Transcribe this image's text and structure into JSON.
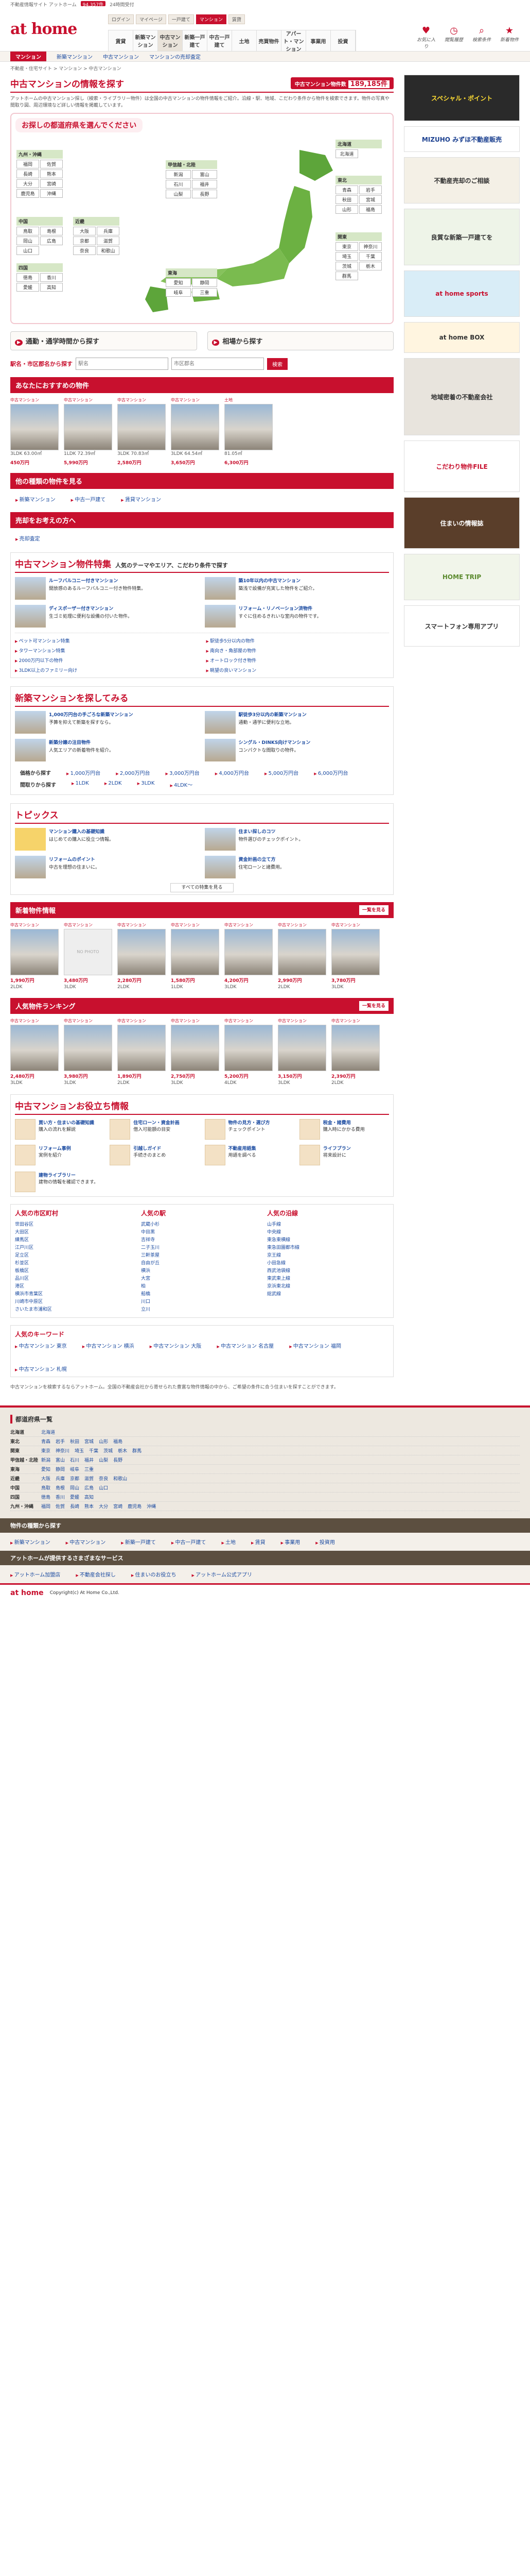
{
  "topstrip": {
    "tagline": "不動産情報サイト アットホーム",
    "badge": "94,357件",
    "note": "24時間受付"
  },
  "header": {
    "logo": "at home",
    "tabs": [
      "ログイン",
      "マイページ",
      "一戸建て",
      "マンション",
      "賃貸"
    ],
    "nav": [
      "賃貸",
      "新築マンション",
      "中古マンション",
      "新築一戸建て",
      "中古一戸建て",
      "土地",
      "売買物件",
      "アパート・マンション",
      "事業用",
      "投資"
    ],
    "icons": [
      {
        "icon": "heart-icon",
        "label": "お気に入り"
      },
      {
        "icon": "clock-icon",
        "label": "閲覧履歴"
      },
      {
        "icon": "search-icon",
        "label": "検索条件"
      },
      {
        "icon": "star-icon",
        "label": "新着物件"
      }
    ]
  },
  "nav2": {
    "current": "マンション",
    "items": [
      "新築マンション",
      "中古マンション",
      "マンションの売却査定"
    ]
  },
  "breadcrumb": "不動産・住宅サイト > マンション > 中古マンション",
  "hero": {
    "title": "中古マンションの情報を探す",
    "count_label": "中古マンション物件数",
    "count": "189,185件",
    "lead": "アットホームの中古マンション探し（検索・ライブラリー物件）は全国の中古マンションの物件情報をご紹介。沿線・駅、地域、こだわり条件から物件を検索できます。物件の写真や間取り図、周辺環境など詳しい情報を掲載しています。"
  },
  "map": {
    "title": "お探しの都道府県を選んでください",
    "regions": [
      {
        "name": "北海道",
        "prefs": [
          "北海道"
        ]
      },
      {
        "name": "東北",
        "prefs": [
          "青森",
          "岩手",
          "秋田",
          "宮城",
          "山形",
          "福島"
        ]
      },
      {
        "name": "甲信越・北陸",
        "prefs": [
          "新潟",
          "富山",
          "石川",
          "福井",
          "山梨",
          "長野"
        ]
      },
      {
        "name": "関東",
        "prefs": [
          "東京",
          "神奈川",
          "埼玉",
          "千葉",
          "茨城",
          "栃木",
          "群馬"
        ]
      },
      {
        "name": "東海",
        "prefs": [
          "愛知",
          "静岡",
          "岐阜",
          "三重"
        ]
      },
      {
        "name": "近畿",
        "prefs": [
          "大阪",
          "兵庫",
          "京都",
          "滋賀",
          "奈良",
          "和歌山"
        ]
      },
      {
        "name": "中国",
        "prefs": [
          "鳥取",
          "島根",
          "岡山",
          "広島",
          "山口"
        ]
      },
      {
        "name": "四国",
        "prefs": [
          "徳島",
          "香川",
          "愛媛",
          "高知"
        ]
      },
      {
        "name": "九州・沖縄",
        "prefs": [
          "福岡",
          "佐賀",
          "長崎",
          "熊本",
          "大分",
          "宮崎",
          "鹿児島",
          "沖縄"
        ]
      }
    ]
  },
  "search": {
    "by_line": "通勤・通学時間から探す",
    "by_price": "相場から探す",
    "keyword_label": "駅名・市区郡名から探す",
    "keyword_placeholder": "駅名",
    "keyword_placeholder2": "市区郡名",
    "go": "検索"
  },
  "recommend": {
    "title": "あなたにおすすめの物件",
    "items": [
      {
        "label": "中古マンション",
        "price": "450万円",
        "meta": "3LDK 63.00㎡"
      },
      {
        "label": "中古マンション",
        "price": "5,990万円",
        "meta": "1LDK 72.39㎡"
      },
      {
        "label": "中古マンション",
        "price": "2,580万円",
        "meta": "3LDK 70.83㎡"
      },
      {
        "label": "中古マンション",
        "price": "3,650万円",
        "meta": "3LDK 64.54㎡"
      },
      {
        "label": "土地",
        "price": "6,300万円",
        "meta": "81.05㎡"
      }
    ]
  },
  "other": {
    "title": "他の種類の物件を見る",
    "links": [
      "新築マンション",
      "中古一戸建て",
      "賃貸マンション"
    ]
  },
  "consider": {
    "title": "売却をお考えの方へ",
    "links": [
      "売却査定"
    ]
  },
  "feature": {
    "title": "中古マンション物件特集",
    "sub": "人気のテーマやエリア、こだわり条件で探す",
    "items": [
      {
        "title": "ルーフバルコニー付きマンション",
        "desc": "開放感のあるルーフバルコニー付き物件特集。"
      },
      {
        "title": "築10年以内の中古マンション",
        "desc": "築浅で設備が充実した物件をご紹介。"
      },
      {
        "title": "ディスポーザー付きマンション",
        "desc": "生ゴミ処理に便利な設備の付いた物件。"
      },
      {
        "title": "リフォーム・リノベーション済物件",
        "desc": "すぐに住めるきれいな室内の物件です。"
      }
    ],
    "mini": [
      "ペット可マンション特集",
      "駅徒歩5分以内の物件",
      "タワーマンション特集",
      "南向き・角部屋の物件",
      "2000万円以下の物件",
      "オートロック付き物件",
      "3LDK以上のファミリー向け",
      "眺望の良いマンション"
    ]
  },
  "newsearch": {
    "title": "新築マンションを探してみる",
    "items": [
      {
        "title": "1,000万円台の手ごろな新築マンション",
        "desc": "予算を抑えて新築を探すなら。"
      },
      {
        "title": "駅徒歩3分以内の新築マンション",
        "desc": "通勤・通学に便利な立地。"
      },
      {
        "title": "新築分譲の注目物件",
        "desc": "人気エリアの新着物件を紹介。"
      },
      {
        "title": "シングル・DINKS向けマンション",
        "desc": "コンパクトな間取りの物件。"
      }
    ],
    "price_label": "価格から探す",
    "prices": [
      "1,000万円台",
      "2,000万円台",
      "3,000万円台",
      "4,000万円台",
      "5,000万円台",
      "6,000万円台"
    ],
    "layout_label": "間取りから探す",
    "layouts": [
      "1LDK",
      "2LDK",
      "3LDK",
      "4LDK～"
    ]
  },
  "library": {
    "title": "トピックス",
    "items": [
      {
        "title": "マンション購入の基礎知識",
        "desc": "はじめての購入に役立つ情報。"
      },
      {
        "title": "住まい探しのコツ",
        "desc": "物件選びのチェックポイント。"
      },
      {
        "title": "リフォームのポイント",
        "desc": "中古を理想の住まいに。"
      },
      {
        "title": "資金計画の立て方",
        "desc": "住宅ローンと諸費用。"
      }
    ],
    "more": "すべての特集を見る"
  },
  "newarrival": {
    "title": "新着物件情報",
    "more": "一覧を見る",
    "items": [
      {
        "label": "中古マンション",
        "price": "1,990万円",
        "meta": "2LDK"
      },
      {
        "label": "中古マンション",
        "price": "3,480万円",
        "meta": "3LDK"
      },
      {
        "label": "中古マンション",
        "price": "2,280万円",
        "meta": "2LDK"
      },
      {
        "label": "中古マンション",
        "price": "1,580万円",
        "meta": "1LDK"
      },
      {
        "label": "中古マンション",
        "price": "4,200万円",
        "meta": "3LDK"
      },
      {
        "label": "中古マンション",
        "price": "2,990万円",
        "meta": "2LDK"
      },
      {
        "label": "中古マンション",
        "price": "3,780万円",
        "meta": "3LDK"
      }
    ]
  },
  "popular": {
    "title": "人気物件ランキング",
    "more": "一覧を見る",
    "items": [
      {
        "label": "中古マンション",
        "price": "2,480万円",
        "meta": "3LDK"
      },
      {
        "label": "中古マンション",
        "price": "3,980万円",
        "meta": "3LDK"
      },
      {
        "label": "中古マンション",
        "price": "1,890万円",
        "meta": "2LDK"
      },
      {
        "label": "中古マンション",
        "price": "2,750万円",
        "meta": "3LDK"
      },
      {
        "label": "中古マンション",
        "price": "5,200万円",
        "meta": "4LDK"
      },
      {
        "label": "中古マンション",
        "price": "3,150万円",
        "meta": "3LDK"
      },
      {
        "label": "中古マンション",
        "price": "2,390万円",
        "meta": "2LDK"
      }
    ]
  },
  "help": {
    "title": "中古マンションお役立ち情報",
    "items": [
      {
        "title": "買い方・住まいの基礎知識",
        "desc": "購入の流れを解説"
      },
      {
        "title": "住宅ローン・資金計画",
        "desc": "借入可能額の目安"
      },
      {
        "title": "物件の見方・選び方",
        "desc": "チェックポイント"
      },
      {
        "title": "税金・諸費用",
        "desc": "購入時にかかる費用"
      },
      {
        "title": "リフォーム事例",
        "desc": "実例を紹介"
      },
      {
        "title": "引越しガイド",
        "desc": "手続きのまとめ"
      },
      {
        "title": "不動産用語集",
        "desc": "用語を調べる"
      },
      {
        "title": "ライフプラン",
        "desc": "将来設計に"
      }
    ],
    "library_title": "建物ライブラリー",
    "library_desc": "建物の情報を確認できます。"
  },
  "popular_areas": {
    "title": "人気の市区町村",
    "areas": [
      "世田谷区",
      "大田区",
      "練馬区",
      "江戸川区",
      "足立区",
      "杉並区",
      "板橋区",
      "品川区",
      "港区",
      "横浜市青葉区",
      "川崎市中原区",
      "さいたま市浦和区"
    ],
    "stations_title": "人気の駅",
    "stations": [
      "武蔵小杉",
      "中目黒",
      "吉祥寺",
      "二子玉川",
      "三軒茶屋",
      "自由が丘",
      "横浜",
      "大宮",
      "柏",
      "船橋",
      "川口",
      "立川"
    ],
    "lines_title": "人気の沿線",
    "lines": [
      "山手線",
      "中央線",
      "東急東横線",
      "東急田園都市線",
      "京王線",
      "小田急線",
      "西武池袋線",
      "東武東上線",
      "京浜東北線",
      "総武線"
    ]
  },
  "keywords": {
    "title": "人気のキーワード",
    "items": [
      "中古マンション 東京",
      "中古マンション 横浜",
      "中古マンション 大阪",
      "中古マンション 名古屋",
      "中古マンション 福岡",
      "中古マンション 札幌"
    ]
  },
  "bottom_lead": "中古マンションを検索するならアットホーム。全国の不動産会社から寄せられた豊富な物件情報の中から、ご希望の条件に合う住まいを探すことができます。",
  "sidebar": {
    "ads": [
      {
        "name": "ad-card-apply",
        "text": "スペシャル・ポイント"
      },
      {
        "name": "ad-mizuho",
        "text": "MIZUHO みずほ不動産販売"
      },
      {
        "name": "ad-realestate",
        "text": "不動産売却のご相談"
      },
      {
        "name": "ad-consult",
        "text": "良質な新築一戸建てを"
      },
      {
        "name": "ad-athome-sports",
        "text": "at home sports"
      },
      {
        "name": "ad-athome-box",
        "text": "at home BOX"
      },
      {
        "name": "ad-local",
        "text": "地域密着の不動産会社"
      },
      {
        "name": "ad-kodawari",
        "text": "こだわり物件FILE"
      },
      {
        "name": "ad-banner",
        "text": "住まいの情報誌"
      },
      {
        "name": "ad-hometrip",
        "text": "HOME TRIP"
      },
      {
        "name": "ad-smartphone",
        "text": "スマートフォン専用アプリ"
      }
    ]
  },
  "footer": {
    "prefs_title": "都道府県一覧",
    "pref_rows": [
      {
        "region": "北海道",
        "prefs": [
          "北海道"
        ]
      },
      {
        "region": "東北",
        "prefs": [
          "青森",
          "岩手",
          "秋田",
          "宮城",
          "山形",
          "福島"
        ]
      },
      {
        "region": "関東",
        "prefs": [
          "東京",
          "神奈川",
          "埼玉",
          "千葉",
          "茨城",
          "栃木",
          "群馬"
        ]
      },
      {
        "region": "甲信越・北陸",
        "prefs": [
          "新潟",
          "富山",
          "石川",
          "福井",
          "山梨",
          "長野"
        ]
      },
      {
        "region": "東海",
        "prefs": [
          "愛知",
          "静岡",
          "岐阜",
          "三重"
        ]
      },
      {
        "region": "近畿",
        "prefs": [
          "大阪",
          "兵庫",
          "京都",
          "滋賀",
          "奈良",
          "和歌山"
        ]
      },
      {
        "region": "中国",
        "prefs": [
          "鳥取",
          "島根",
          "岡山",
          "広島",
          "山口"
        ]
      },
      {
        "region": "四国",
        "prefs": [
          "徳島",
          "香川",
          "愛媛",
          "高知"
        ]
      },
      {
        "region": "九州・沖縄",
        "prefs": [
          "福岡",
          "佐賀",
          "長崎",
          "熊本",
          "大分",
          "宮崎",
          "鹿児島",
          "沖縄"
        ]
      }
    ],
    "type_title": "物件の種類から探す",
    "types": [
      "新築マンション",
      "中古マンション",
      "新築一戸建て",
      "中古一戸建て",
      "土地",
      "賃貸",
      "事業用",
      "投資用"
    ],
    "service_title": "アットホームが提供するさまざまなサービス",
    "services": [
      "アットホーム加盟店",
      "不動産会社探し",
      "住まいのお役立ち",
      "アットホーム公式アプリ"
    ],
    "logo": "at home",
    "copyright": "Copyright(c) At Home Co.,Ltd."
  }
}
